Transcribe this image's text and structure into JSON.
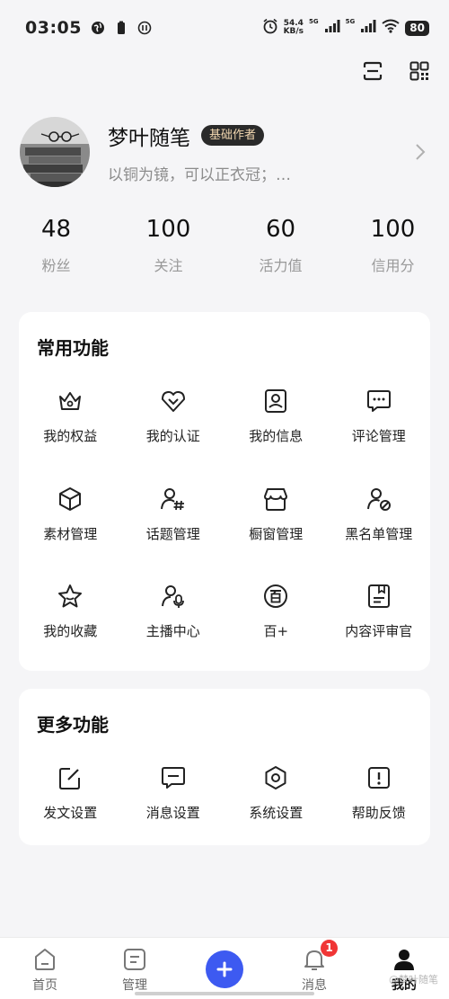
{
  "status_bar": {
    "time": "03:05",
    "net_speed_value": "54.4",
    "net_speed_unit": "KB/s",
    "signal_tag_1": "5G",
    "signal_tag_2": "5G",
    "battery": "80"
  },
  "profile": {
    "username": "梦叶随笔",
    "level_badge": "基础作者",
    "bio": "以铜为镜，可以正衣冠；…"
  },
  "stats": [
    {
      "value": "48",
      "label": "粉丝"
    },
    {
      "value": "100",
      "label": "关注"
    },
    {
      "value": "60",
      "label": "活力值"
    },
    {
      "value": "100",
      "label": "信用分"
    }
  ],
  "common_functions": {
    "title": "常用功能",
    "items": [
      {
        "label": "我的权益",
        "icon": "crown-icon"
      },
      {
        "label": "我的认证",
        "icon": "verified-heart-icon"
      },
      {
        "label": "我的信息",
        "icon": "profile-card-icon"
      },
      {
        "label": "评论管理",
        "icon": "comment-icon"
      },
      {
        "label": "素材管理",
        "icon": "cube-icon"
      },
      {
        "label": "话题管理",
        "icon": "topic-icon"
      },
      {
        "label": "橱窗管理",
        "icon": "store-icon"
      },
      {
        "label": "黑名单管理",
        "icon": "block-user-icon"
      },
      {
        "label": "我的收藏",
        "icon": "star-icon"
      },
      {
        "label": "主播中心",
        "icon": "host-mic-icon"
      },
      {
        "label": "百+",
        "icon": "bai-plus-icon"
      },
      {
        "label": "内容评审官",
        "icon": "review-icon"
      }
    ]
  },
  "more_functions": {
    "title": "更多功能",
    "items": [
      {
        "label": "发文设置",
        "icon": "edit-icon"
      },
      {
        "label": "消息设置",
        "icon": "message-icon"
      },
      {
        "label": "系统设置",
        "icon": "settings-icon"
      },
      {
        "label": "帮助反馈",
        "icon": "help-icon"
      }
    ]
  },
  "bottom_nav": {
    "items": [
      {
        "label": "首页",
        "icon": "home-icon"
      },
      {
        "label": "管理",
        "icon": "manage-icon"
      },
      {
        "label": "",
        "icon": "plus-icon"
      },
      {
        "label": "消息",
        "icon": "bell-icon",
        "badge": "1"
      },
      {
        "label": "我的",
        "icon": "user-icon"
      }
    ],
    "active_index": 4
  },
  "watermark": "@梦叶随笔",
  "colors": {
    "accent": "#3d5af1",
    "badge": "#f03535",
    "background": "#f5f5f7"
  }
}
